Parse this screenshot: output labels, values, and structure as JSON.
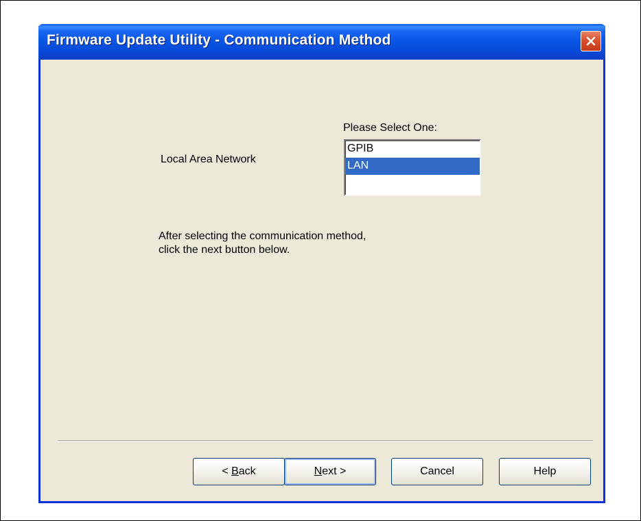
{
  "window": {
    "title": "Firmware Update Utility - Communication Method",
    "close_icon": "close-icon",
    "close_color": "#d9502e",
    "title_color": "#0a54e3"
  },
  "content": {
    "selection_label": "Local Area Network",
    "list_prompt": "Please Select One:",
    "list_items": [
      "GPIB",
      "LAN"
    ],
    "selected_item": "LAN",
    "instructions_line1": "After selecting the communication method,",
    "instructions_line2": "click the next button below."
  },
  "buttons": {
    "back_prefix": "< ",
    "back_accel": "B",
    "back_rest": "ack",
    "next_accel": "N",
    "next_rest": "ext >",
    "cancel": "Cancel",
    "help": "Help"
  },
  "colors": {
    "dialog_bg": "#ece9d8",
    "selection_bg": "#316ac5",
    "border": "#0831d9"
  }
}
